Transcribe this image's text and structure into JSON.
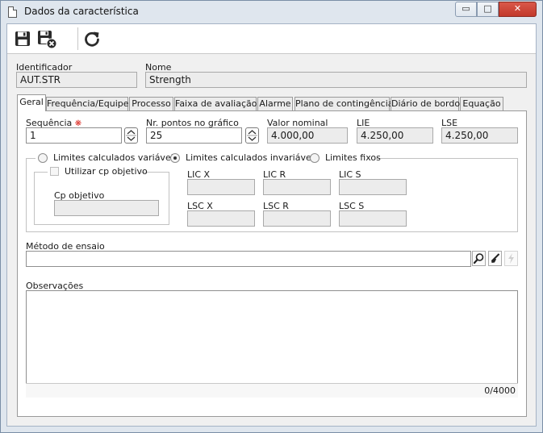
{
  "window": {
    "title": "Dados da característica",
    "controls": {
      "minimize": "▭",
      "maximize": "□",
      "close": "✕"
    }
  },
  "toolbar": {
    "items": [
      {
        "name": "save-icon"
      },
      {
        "name": "save-and-close-icon"
      },
      {
        "name": "refresh-icon"
      }
    ]
  },
  "header": {
    "identificador_label": "Identificador",
    "identificador_value": "AUT.STR",
    "nome_label": "Nome",
    "nome_value": "Strength"
  },
  "tabs": [
    {
      "label": "Geral",
      "active": true
    },
    {
      "label": "Frequência/Equipe"
    },
    {
      "label": "Processo"
    },
    {
      "label": "Faixa de avaliação"
    },
    {
      "label": "Alarme"
    },
    {
      "label": "Plano de contingência"
    },
    {
      "label": "Diário de bordo"
    },
    {
      "label": "Equação"
    }
  ],
  "geral": {
    "sequencia_label": "Sequência",
    "sequencia_required_mark": "❋",
    "sequencia_value": "1",
    "pontos_label": "Nr. pontos no gráfico",
    "pontos_value": "25",
    "valor_nominal_label": "Valor nominal",
    "valor_nominal_value": "4.000,00",
    "lie_label": "LIE",
    "lie_value": "4.250,00",
    "lse_label": "LSE",
    "lse_value": "4.250,00",
    "limits_radios": [
      {
        "label": "Limites calculados variáveis",
        "checked": false
      },
      {
        "label": "Limites calculados invariáveis",
        "checked": true
      },
      {
        "label": "Limites fixos",
        "checked": false
      }
    ],
    "utilizar_cp_label": "Utilizar cp objetivo",
    "cp_objetivo_label": "Cp objetivo",
    "cp_objetivo_value": "",
    "lic_x_label": "LIC X",
    "lic_r_label": "LIC R",
    "lic_s_label": "LIC S",
    "lsc_x_label": "LSC X",
    "lsc_r_label": "LSC R",
    "lsc_s_label": "LSC S",
    "metodo_label": "Método de ensaio",
    "metodo_value": "",
    "observacoes_label": "Observações",
    "observacoes_value": "",
    "char_counter": "0/4000"
  }
}
